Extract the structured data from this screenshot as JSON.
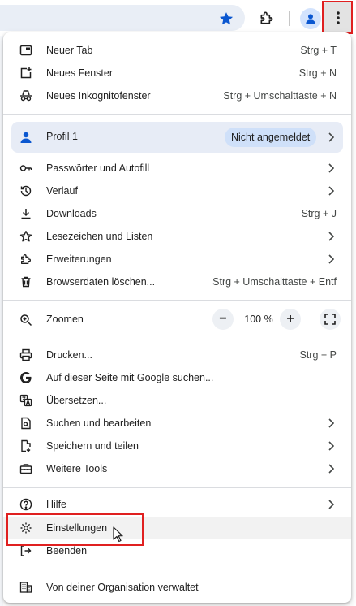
{
  "toolbar": {
    "bookmark_icon": "star-filled-icon",
    "extensions_icon": "puzzle-icon",
    "profile_icon": "person-icon",
    "menu_icon": "kebab-menu-icon",
    "accent_color": "#0b57d0"
  },
  "menu": {
    "group1": [
      {
        "label": "Neuer Tab",
        "shortcut": "Strg + T",
        "icon": "new-tab-icon"
      },
      {
        "label": "Neues Fenster",
        "shortcut": "Strg + N",
        "icon": "new-window-icon"
      },
      {
        "label": "Neues Inkognitofenster",
        "shortcut": "Strg + Umschalttaste + N",
        "icon": "incognito-icon"
      }
    ],
    "profile": {
      "label": "Profil 1",
      "status": "Nicht angemeldet",
      "icon": "person-icon"
    },
    "group2": [
      {
        "label": "Passwörter und Autofill",
        "icon": "key-icon",
        "submenu": true
      },
      {
        "label": "Verlauf",
        "icon": "history-icon",
        "submenu": true
      },
      {
        "label": "Downloads",
        "shortcut": "Strg + J",
        "icon": "download-icon"
      },
      {
        "label": "Lesezeichen und Listen",
        "icon": "star-outline-icon",
        "submenu": true
      },
      {
        "label": "Erweiterungen",
        "icon": "puzzle-icon",
        "submenu": true
      },
      {
        "label": "Browserdaten löschen...",
        "shortcut": "Strg + Umschalttaste + Entf",
        "icon": "trash-icon"
      }
    ],
    "zoom": {
      "label": "Zoomen",
      "value": "100 %",
      "minus": "−",
      "plus": "+",
      "icon": "zoom-icon"
    },
    "group3": [
      {
        "label": "Drucken...",
        "shortcut": "Strg + P",
        "icon": "print-icon"
      },
      {
        "label": "Auf dieser Seite mit Google suchen...",
        "icon": "google-g-icon"
      },
      {
        "label": "Übersetzen...",
        "icon": "translate-icon"
      },
      {
        "label": "Suchen und bearbeiten",
        "icon": "find-page-icon",
        "submenu": true
      },
      {
        "label": "Speichern und teilen",
        "icon": "save-share-icon",
        "submenu": true
      },
      {
        "label": "Weitere Tools",
        "icon": "toolbox-icon",
        "submenu": true
      }
    ],
    "group4": [
      {
        "label": "Hilfe",
        "icon": "help-icon",
        "submenu": true
      },
      {
        "label": "Einstellungen",
        "icon": "gear-icon",
        "highlighted": true
      },
      {
        "label": "Beenden",
        "icon": "exit-icon"
      }
    ],
    "managed": {
      "label": "Von deiner Organisation verwaltet",
      "icon": "building-icon"
    }
  }
}
